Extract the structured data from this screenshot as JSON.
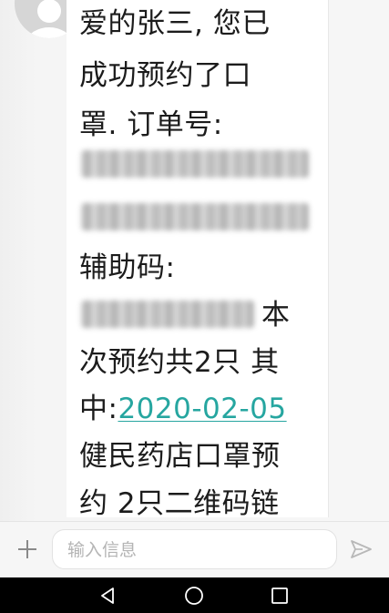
{
  "message": {
    "lines": [
      "爱的张三, 您已",
      "成功预约了口",
      "罩. 订单号:",
      "辅助码:",
      "本",
      "次预约共2只 其",
      "中:",
      "2020-02-05",
      "健民药店口罩预",
      "约 2只二维码链"
    ]
  },
  "composer": {
    "add_icon": "plus-icon",
    "placeholder": "输入信息",
    "send_icon": "send-icon"
  },
  "navbar": {
    "back_icon": "triangle-back-icon",
    "home_icon": "circle-home-icon",
    "recents_icon": "square-recents-icon"
  },
  "colors": {
    "link": "#26a6a0",
    "text": "#1c1c1c",
    "navbar": "#000000"
  }
}
